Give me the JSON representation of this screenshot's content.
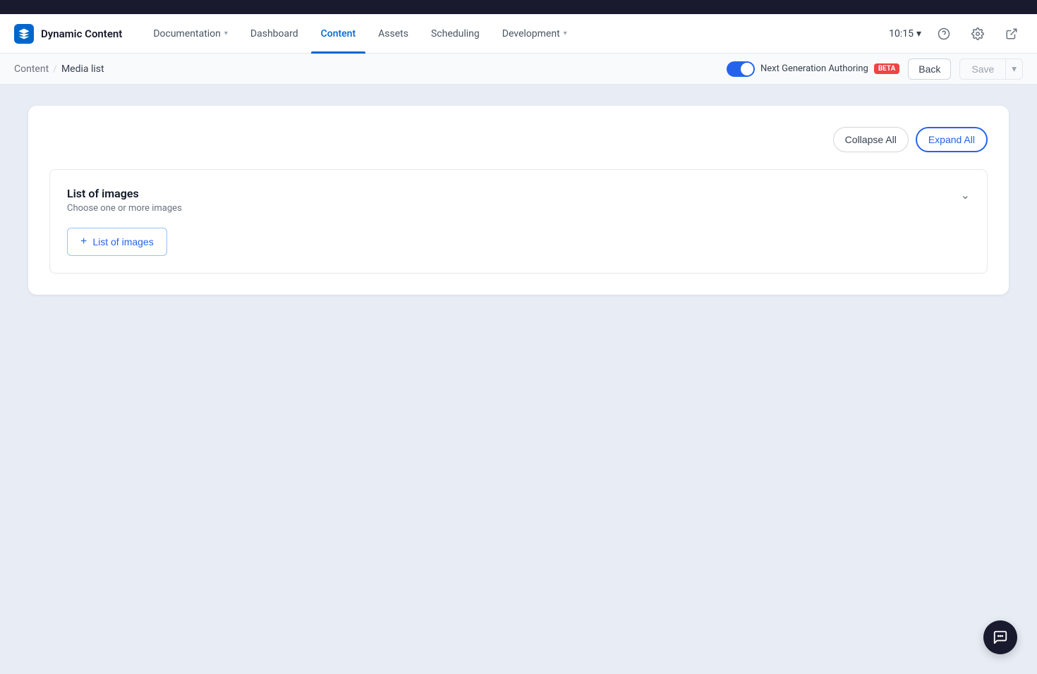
{
  "topbar": {},
  "navbar": {
    "logo_text": "Dynamic Content",
    "nav_items": [
      {
        "label": "Documentation",
        "has_chevron": true,
        "active": false
      },
      {
        "label": "Dashboard",
        "has_chevron": false,
        "active": false
      },
      {
        "label": "Content",
        "has_chevron": false,
        "active": true
      },
      {
        "label": "Assets",
        "has_chevron": false,
        "active": false
      },
      {
        "label": "Scheduling",
        "has_chevron": false,
        "active": false
      },
      {
        "label": "Development",
        "has_chevron": true,
        "active": false
      }
    ],
    "time": "10:15",
    "time_chevron": "▾"
  },
  "breadcrumb": {
    "parent": "Content",
    "separator": "/",
    "current": "Media list"
  },
  "next_gen": {
    "label": "Next Generation Authoring",
    "beta_label": "BETA"
  },
  "toolbar": {
    "back_label": "Back",
    "save_label": "Save"
  },
  "card": {
    "collapse_all_label": "Collapse All",
    "expand_all_label": "Expand All"
  },
  "section": {
    "title": "List of images",
    "subtitle": "Choose one or more images",
    "chevron": "⌄",
    "add_button_label": "List of images",
    "plus": "+"
  },
  "chat_button": {
    "icon": "💬"
  }
}
